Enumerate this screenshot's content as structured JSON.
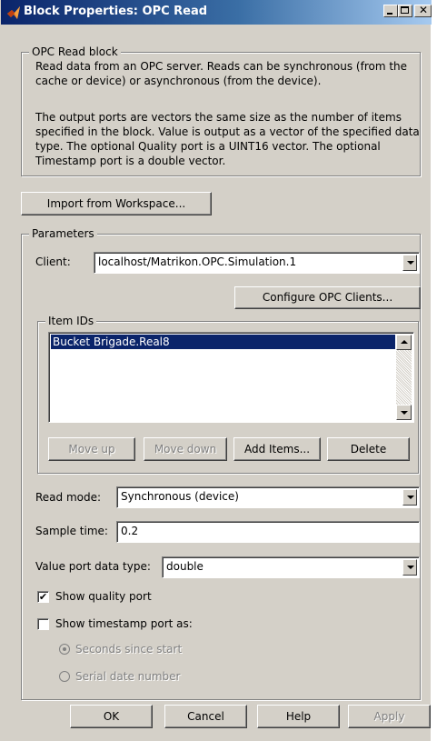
{
  "window": {
    "title": "Block Properties: OPC Read"
  },
  "description": {
    "legend": "OPC Read block",
    "paragraph1": "Read data from an OPC server. Reads can be synchronous (from the cache or device) or asynchronous (from the device).",
    "paragraph2": "The output ports are vectors the same size as the number of items specified in the block. Value is output as a vector of the specified data type. The optional Quality port is a UINT16 vector. The optional Timestamp port is a double vector."
  },
  "import_button": "Import from Workspace...",
  "parameters": {
    "legend": "Parameters",
    "client_label": "Client:",
    "client_value": "localhost/Matrikon.OPC.Simulation.1",
    "configure_button": "Configure OPC Clients...",
    "item_ids": {
      "legend": "Item IDs",
      "items": [
        "Bucket Brigade.Real8"
      ],
      "move_up": "Move up",
      "move_down": "Move down",
      "add_items": "Add Items...",
      "delete": "Delete"
    },
    "read_mode_label": "Read mode:",
    "read_mode_value": "Synchronous (device)",
    "sample_time_label": "Sample time:",
    "sample_time_value": "0.2",
    "value_port_label": "Value port data type:",
    "value_port_value": "double",
    "show_quality_label": "Show quality port",
    "show_quality_checked": true,
    "show_timestamp_label": "Show timestamp port as:",
    "show_timestamp_checked": false,
    "radio_seconds": "Seconds since start",
    "radio_serial": "Serial date number"
  },
  "buttons": {
    "ok": "OK",
    "cancel": "Cancel",
    "help": "Help",
    "apply": "Apply"
  },
  "colors": {
    "titlebar_start": "#0a246a",
    "titlebar_end": "#a6caf0",
    "dialog_bg": "#d4d0c8",
    "selection": "#0a246a"
  },
  "icons": {
    "title": "matlab-logo-icon",
    "minimize": "minimize-icon",
    "maximize": "maximize-icon",
    "close": "close-icon"
  }
}
